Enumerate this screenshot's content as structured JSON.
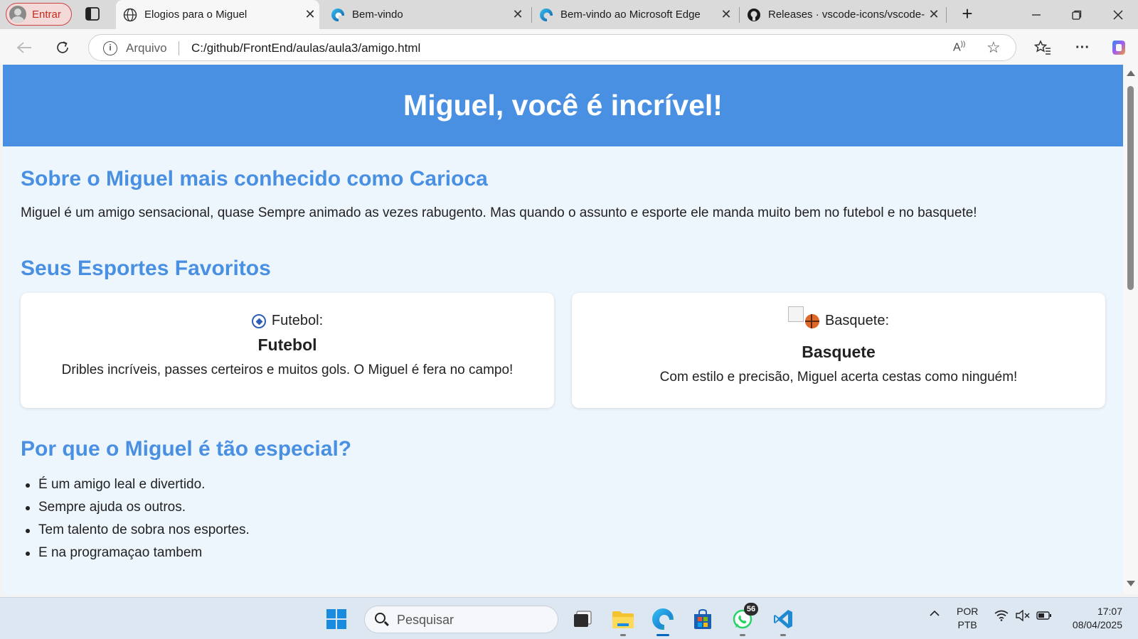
{
  "browser": {
    "profile_label": "Entrar",
    "tabs": [
      {
        "title": "Elogios para o Miguel",
        "icon": "globe-icon"
      },
      {
        "title": "Bem-vindo",
        "icon": "edge-icon"
      },
      {
        "title": "Bem-vindo ao Microsoft Edge",
        "icon": "edge-icon"
      },
      {
        "title": "Releases · vscode-icons/vscode-i",
        "icon": "github-icon"
      }
    ],
    "close_glyph": "✕",
    "new_tab_glyph": "+",
    "address": {
      "scheme_label": "Arquivo",
      "url": "C:/github/FrontEnd/aulas/aula3/amigo.html"
    }
  },
  "page": {
    "header_title": "Miguel, você é incrível!",
    "about": {
      "title": "Sobre o Miguel mais conhecido como Carioca",
      "text": "Miguel é um amigo sensacional, quase Sempre animado as vezes rabugento. Mas quando o assunto e esporte ele manda muito bem no futebol e no basquete!"
    },
    "sports": {
      "title": "Seus Esportes Favoritos",
      "cards": [
        {
          "img_alt": "Futebol:",
          "title": "Futebol",
          "desc": "Dribles incríveis, passes certeiros e muitos gols. O Miguel é fera no campo!",
          "icon": "soccer-ball-icon"
        },
        {
          "img_alt": "Basquete:",
          "title": "Basquete",
          "desc": "Com estilo e precisão, Miguel acerta cestas como ninguém!",
          "icon": "basketball-icon"
        }
      ]
    },
    "special": {
      "title": "Por que o Miguel é tão especial?",
      "items": [
        "É um amigo leal e divertido.",
        "Sempre ajuda os outros.",
        "Tem talento de sobra nos esportes.",
        "E na programaçao tambem"
      ]
    }
  },
  "taskbar": {
    "search_placeholder": "Pesquisar",
    "whatsapp_badge": "56",
    "lang_line1": "POR",
    "lang_line2": "PTB",
    "time": "17:07",
    "date": "08/04/2025"
  },
  "colors": {
    "accent": "#4a90e2",
    "page_bg": "#eef6fd",
    "taskbar_bg": "#dde7f2"
  }
}
